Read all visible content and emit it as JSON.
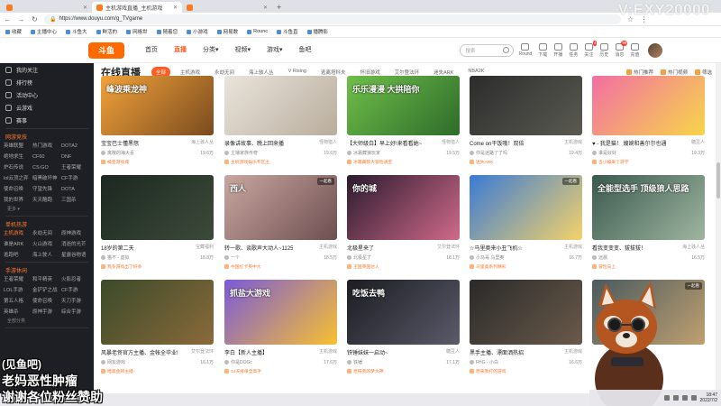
{
  "browser": {
    "tabs": [
      {
        "label": "",
        "active": false
      },
      {
        "label": "主机游戏直播_主机游戏",
        "active": true
      },
      {
        "label": "",
        "active": false
      }
    ],
    "new_tab": "+",
    "url": "https://www.douyu.com/g_TVgame",
    "controls": [
      "—",
      "☐",
      "✕"
    ]
  },
  "bookmarks": [
    "收藏",
    "主播中心",
    "斗鱼大",
    "鲜活的",
    "网格世",
    "随着您",
    "小游戏",
    "网易数",
    "Rounc",
    "斗鱼直",
    "播腾影"
  ],
  "watermark": "V:EXY20000",
  "header": {
    "logo": "斗鱼",
    "nav": [
      {
        "label": "首页",
        "active": false
      },
      {
        "label": "直播",
        "active": true
      },
      {
        "label": "分类▾",
        "active": false
      },
      {
        "label": "视频▾",
        "active": false
      },
      {
        "label": "游戏▾",
        "active": false
      },
      {
        "label": "鱼吧",
        "active": false
      }
    ],
    "search_placeholder": "搜索",
    "icons": [
      {
        "name": "round-icon",
        "label": "Round",
        "badge": ""
      },
      {
        "name": "download-icon",
        "label": "下载",
        "badge": ""
      },
      {
        "name": "broadcast-icon",
        "label": "开播",
        "badge": ""
      },
      {
        "name": "task-icon",
        "label": "任务",
        "badge": ""
      },
      {
        "name": "follow-icon",
        "label": "关注",
        "badge": "4"
      },
      {
        "name": "history-icon",
        "label": "历史",
        "badge": ""
      },
      {
        "name": "message-icon",
        "label": "消息",
        "badge": "99"
      },
      {
        "name": "recharge-icon",
        "label": "充值",
        "badge": ""
      }
    ]
  },
  "sidebar": {
    "top_items": [
      {
        "label": "我的关注",
        "icon": "heart-icon"
      },
      {
        "label": "排行榜",
        "icon": "rank-icon"
      },
      {
        "label": "活动中心",
        "icon": "activity-icon"
      },
      {
        "label": "云游戏",
        "icon": "cloud-icon"
      },
      {
        "label": "赛事",
        "icon": "trophy-icon"
      }
    ],
    "groups": [
      {
        "title": "网游竞技",
        "items": [
          "英雄联盟",
          "热门游戏",
          "DOTA2",
          "绝地求生",
          "CF60",
          "DNF",
          "炉石传说",
          "CS:GO",
          "王者荣耀",
          "lol云顶之弈",
          "暗黑破坏神",
          "CF手游",
          "使命召唤",
          "守望先锋",
          "DOTA",
          "我的世界",
          "天天酷跑",
          "三国杀"
        ],
        "more": "更多 ▾"
      },
      {
        "title": "单机热游",
        "items": [
          "主机游戏",
          "永劫无间",
          "原神游戏",
          "谁是ARK",
          "火山游戏",
          "消逝的光芒",
          "逃跑吧",
          "海上驶人",
          "星露谷物语"
        ],
        "more": ""
      },
      {
        "title": "手游休闲",
        "items": [
          "王者荣耀",
          "和平精英",
          "火影忍者",
          "LOL手游",
          "金铲铲之战",
          "CF手游",
          "第五人格",
          "使命召唤",
          "天刀手游",
          "英雄杀",
          "原神手游",
          "综合手游"
        ],
        "more": "全部分类"
      }
    ]
  },
  "content": {
    "title": "在线直播",
    "chips": [
      {
        "label": "全部",
        "active": true
      },
      {
        "label": "主机游戏",
        "active": false
      },
      {
        "label": "永劫无间",
        "active": false
      },
      {
        "label": "海上骇人丛",
        "active": false
      },
      {
        "label": "V Rising",
        "active": false
      },
      {
        "label": "逃离塔科夫",
        "active": false
      },
      {
        "label": "怀旧游戏",
        "active": false
      },
      {
        "label": "艾尔登法环",
        "active": false
      },
      {
        "label": "迷失ARK",
        "active": false
      },
      {
        "label": "NBA2K",
        "active": false
      }
    ],
    "right_links": [
      "热门推荐",
      "热门视频",
      "筛选"
    ]
  },
  "cards": [
    {
      "title": "宝宝巴士懂黑怒",
      "category": "海上骇人丛",
      "streamer": "离散的海大喜",
      "heat": "19.6万",
      "tag": "橘宝游戏城",
      "thumb_text": "峰波乘龙神",
      "corner": "",
      "colors": [
        "#f2a23a",
        "#7a4b1e"
      ]
    },
    {
      "title": "录像讲故事、晚上回来播",
      "category": "怪物猎人",
      "streamer": "主播家族传奇",
      "heat": "19.6万",
      "tag": "主机游戏娱乐专区主",
      "thumb_text": "",
      "corner": "",
      "colors": [
        "#e9e4dc",
        "#b9ad9c"
      ]
    },
    {
      "title": "【大师级白】早上好!来看看她~",
      "category": "怪物猎人",
      "streamer": "冰霜藏狼玩家",
      "heat": "19.5万",
      "tag": "冰霜藏狼大冒险通宝",
      "thumb_text": "乐乐漫漫 大拱陪你",
      "corner": "",
      "colors": [
        "#6fbf4a",
        "#2e6b2a"
      ]
    },
    {
      "title": "Come on干饭哦！双倍",
      "category": "主机游戏",
      "streamer": "你是迷路了了吗",
      "heat": "19.4万",
      "tag": "迷失ARK",
      "thumb_text": "",
      "corner": "",
      "colors": [
        "#2c2c2c",
        "#5a5a52"
      ]
    },
    {
      "title": "♥ - 我是猫！ 嫂婉和善尔尔也通",
      "category": "糖豆人",
      "streamer": "谁是好好",
      "heat": "19.3万",
      "tag": "当小编来了游学",
      "thumb_text": "",
      "corner": "",
      "colors": [
        "#f26ea3",
        "#f7d64a"
      ]
    },
    {
      "title": "18岁的第二天",
      "category": "宝藏福利",
      "streamer": "猫不 - 虚拟",
      "heat": "18.8万",
      "tag": "我多游戏出了好多",
      "thumb_text": "",
      "corner": "",
      "colors": [
        "#1c2820",
        "#3c4a3a"
      ]
    },
    {
      "title": "转一歌、谈歌声大动人~1125",
      "category": "主机游戏",
      "streamer": "一个",
      "heat": "18.5万",
      "tag": "中国红卡英中大",
      "thumb_text": "西人",
      "corner": "一起看",
      "colors": [
        "#c8a7a0",
        "#6e4e50"
      ]
    },
    {
      "title": "北极星来了",
      "category": "艾尔登法环",
      "streamer": "北极星了",
      "heat": "18.1万",
      "tag": "王国英国达人",
      "thumb_text": "你的城",
      "corner": "",
      "colors": [
        "#2b1b2e",
        "#d06a8a"
      ]
    },
    {
      "title": "☆马里奥来小丑飞机☆",
      "category": "主机游戏",
      "streamer": "小马哥 马里奥",
      "heat": "16.7万",
      "tag": "马里奥系列精彩",
      "thumb_text": "",
      "corner": "一起看",
      "colors": [
        "#3a7bd5",
        "#f4d26a"
      ]
    },
    {
      "title": "看我变变变、拔拔拔！",
      "category": "海上骇人丛",
      "streamer": "远晨",
      "heat": "16.5万",
      "tag": "冒险向上 ",
      "thumb_text": "全能型选手 顶级狼人思路",
      "corner": "",
      "colors": [
        "#3a5a4e",
        "#9fb5a0"
      ]
    },
    {
      "title": "风暴老佟官方主播、金帐全毕业!",
      "category": "艾尔登法环",
      "streamer": "网友游戏",
      "heat": "16.1万",
      "tag": "暗黑金牌主播",
      "thumb_text": "",
      "corner": "",
      "colors": [
        "#3b4a2a",
        "#8a6a3a"
      ]
    },
    {
      "title": "李白【新人主播】",
      "category": "主机游戏",
      "streamer": "你是DOGc",
      "heat": "17.6万",
      "tag": "14天接单全高手",
      "thumb_text": "抓盐大游戏",
      "corner": "",
      "colors": [
        "#7a5ad8",
        "#f8c030"
      ]
    },
    {
      "title": "铁锤妹妹一启动~",
      "category": "糖豆人",
      "streamer": "铁锤",
      "heat": "17.1万",
      "tag": "老铁我的梦大神",
      "thumb_text": "吃饭去鸭",
      "corner": "",
      "colors": [
        "#1c1c22",
        "#5a5a6a"
      ]
    },
    {
      "title": "黑手主播、漂面洒热招",
      "category": "主机游戏",
      "streamer": "FHG - 小白",
      "heat": "16.6万",
      "tag": "原来我打的游戏",
      "thumb_text": "",
      "corner": "",
      "colors": [
        "#2a2a2a",
        "#6a5a4a"
      ]
    },
    {
      "title": "",
      "category": "",
      "streamer": "",
      "heat": "",
      "tag": "",
      "thumb_text": "",
      "corner": "一起看",
      "colors": [
        "#4a5a5e",
        "#c0a070"
      ]
    }
  ],
  "overlay": {
    "line1": "(见鱼吧)",
    "line2": "老妈恶性肿瘤",
    "line3": "谢谢各位粉丝赞助"
  },
  "taskbar": {
    "time": "18:47",
    "date": "2022/7/2"
  }
}
